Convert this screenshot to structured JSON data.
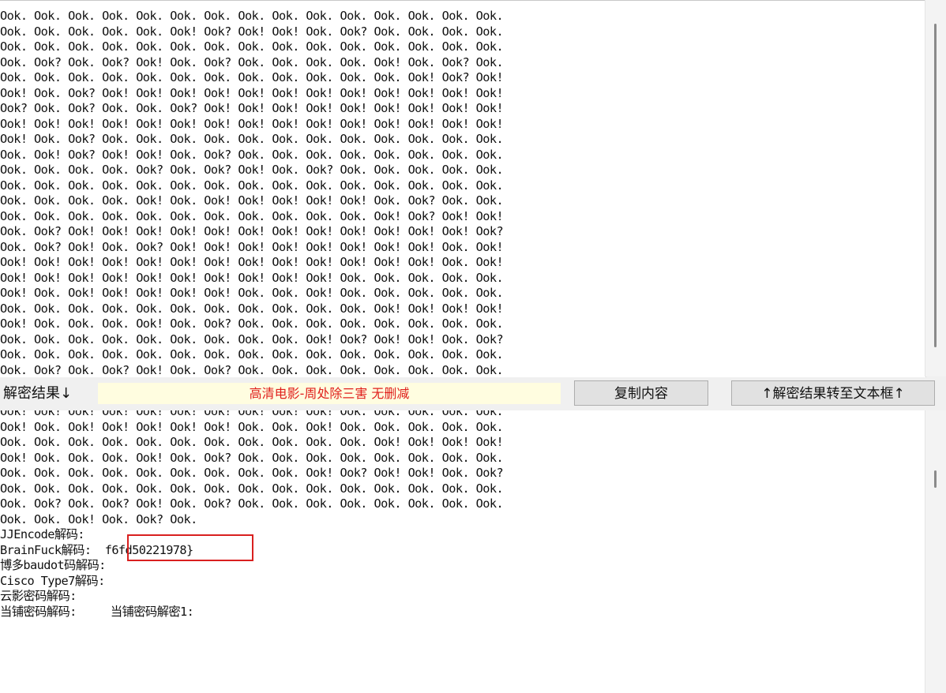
{
  "top_text": [
    "Ook. Ook. Ook. Ook. Ook. Ook. Ook. Ook. Ook. Ook. Ook. Ook. Ook. Ook. Ook.",
    "Ook. Ook. Ook. Ook. Ook. Ook! Ook? Ook! Ook! Ook. Ook? Ook. Ook. Ook. Ook.",
    "Ook. Ook. Ook. Ook. Ook. Ook. Ook. Ook. Ook. Ook. Ook. Ook. Ook. Ook. Ook.",
    "Ook. Ook? Ook. Ook? Ook! Ook. Ook? Ook. Ook. Ook. Ook. Ook! Ook. Ook? Ook.",
    "Ook. Ook. Ook. Ook. Ook. Ook. Ook. Ook. Ook. Ook. Ook. Ook. Ook! Ook? Ook!",
    "Ook! Ook. Ook? Ook! Ook! Ook! Ook! Ook! Ook! Ook! Ook! Ook! Ook! Ook! Ook!",
    "Ook? Ook. Ook? Ook. Ook. Ook? Ook! Ook! Ook! Ook! Ook! Ook! Ook! Ook! Ook!",
    "Ook! Ook! Ook! Ook! Ook! Ook! Ook! Ook! Ook! Ook! Ook! Ook! Ook! Ook! Ook!",
    "Ook! Ook. Ook? Ook. Ook. Ook. Ook. Ook. Ook. Ook. Ook. Ook. Ook. Ook. Ook.",
    "Ook. Ook! Ook? Ook! Ook! Ook. Ook? Ook. Ook. Ook. Ook. Ook. Ook. Ook. Ook.",
    "Ook. Ook. Ook. Ook. Ook? Ook. Ook? Ook! Ook. Ook? Ook. Ook. Ook. Ook. Ook.",
    "Ook. Ook. Ook. Ook. Ook. Ook. Ook. Ook. Ook. Ook. Ook. Ook. Ook. Ook. Ook.",
    "Ook. Ook. Ook. Ook. Ook! Ook. Ook! Ook! Ook! Ook! Ook! Ook. Ook? Ook. Ook.",
    "Ook. Ook. Ook. Ook. Ook. Ook. Ook. Ook. Ook. Ook. Ook. Ook! Ook? Ook! Ook!",
    "Ook. Ook? Ook! Ook! Ook! Ook! Ook! Ook! Ook! Ook! Ook! Ook! Ook! Ook! Ook?",
    "Ook. Ook? Ook! Ook. Ook? Ook! Ook! Ook! Ook! Ook! Ook! Ook! Ook! Ook. Ook!",
    "Ook! Ook! Ook! Ook! Ook! Ook! Ook! Ook! Ook! Ook! Ook! Ook! Ook! Ook. Ook!",
    "Ook! Ook! Ook! Ook! Ook! Ook! Ook! Ook! Ook! Ook! Ook. Ook. Ook. Ook. Ook.",
    "Ook! Ook. Ook! Ook! Ook! Ook! Ook! Ook. Ook. Ook! Ook. Ook. Ook. Ook. Ook.",
    "Ook. Ook. Ook. Ook. Ook. Ook. Ook. Ook. Ook. Ook. Ook. Ook! Ook! Ook! Ook!",
    "Ook! Ook. Ook. Ook. Ook! Ook. Ook? Ook. Ook. Ook. Ook. Ook. Ook. Ook. Ook.",
    "Ook. Ook. Ook. Ook. Ook. Ook. Ook. Ook. Ook. Ook! Ook? Ook! Ook! Ook. Ook?",
    "Ook. Ook. Ook. Ook. Ook. Ook. Ook. Ook. Ook. Ook. Ook. Ook. Ook. Ook. Ook.",
    "Ook. Ook? Ook. Ook? Ook! Ook. Ook? Ook. Ook. Ook. Ook. Ook. Ook. Ook. Ook."
  ],
  "toolbar": {
    "result_label": "解密结果↓",
    "banner": "高清电影-周处除三害 无删减",
    "copy_button": "复制内容",
    "transfer_button": "↑解密结果转至文本框↑"
  },
  "bottom_text": [
    "Ook! Ook! Ook! Ook! Ook! Ook! Ook! Ook! Ook! Ook! Ook. Ook. Ook. Ook. Ook.",
    "Ook! Ook. Ook! Ook! Ook! Ook! Ook! Ook. Ook. Ook! Ook. Ook. Ook. Ook. Ook.",
    "Ook. Ook. Ook. Ook. Ook. Ook. Ook. Ook. Ook. Ook. Ook. Ook! Ook! Ook! Ook!",
    "Ook! Ook. Ook. Ook. Ook! Ook. Ook? Ook. Ook. Ook. Ook. Ook. Ook. Ook. Ook.",
    "Ook. Ook. Ook. Ook. Ook. Ook. Ook. Ook. Ook. Ook! Ook? Ook! Ook! Ook. Ook?",
    "Ook. Ook. Ook. Ook. Ook. Ook. Ook. Ook. Ook. Ook. Ook. Ook. Ook. Ook. Ook.",
    "Ook. Ook? Ook. Ook? Ook! Ook. Ook? Ook. Ook. Ook. Ook. Ook. Ook. Ook. Ook.",
    "Ook. Ook. Ook! Ook. Ook? Ook.",
    "JJEncode解码:",
    "BrainFuck解码:  f6fd50221978}",
    "博多baudot码解码:",
    "Cisco Type7解码:",
    "云影密码解码:",
    "当铺密码解码:     当铺密码解密1:"
  ]
}
